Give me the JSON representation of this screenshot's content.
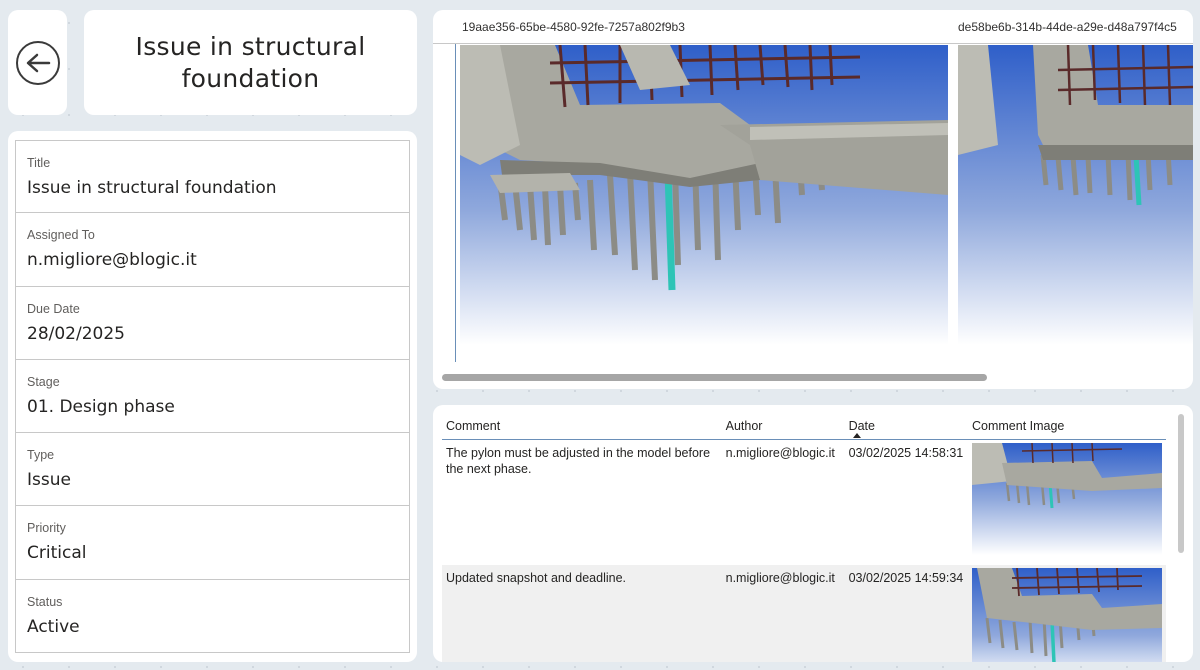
{
  "header": {
    "title": "Issue in structural foundation",
    "back_icon": "arrow-left-circle-icon"
  },
  "details": {
    "fields": [
      {
        "label": "Title",
        "value": "Issue in structural foundation"
      },
      {
        "label": "Assigned To",
        "value": "n.migliore@blogic.it"
      },
      {
        "label": "Due Date",
        "value": "28/02/2025"
      },
      {
        "label": "Stage",
        "value": "01. Design phase"
      },
      {
        "label": "Type",
        "value": "Issue"
      },
      {
        "label": "Priority",
        "value": "Critical"
      },
      {
        "label": "Status",
        "value": "Active"
      }
    ]
  },
  "images": {
    "ids": [
      "19aae356-65be-4580-92fe-7257a802f9b3",
      "de58be6b-314b-44de-a29e-d48a797f4c5"
    ]
  },
  "comments": {
    "columns": [
      "Comment",
      "Author",
      "Date",
      "Comment Image"
    ],
    "sorted_column": "Date",
    "rows": [
      {
        "comment": "The pylon must be adjusted in the model before the next phase.",
        "author": "n.migliore@blogic.it",
        "date": "03/02/2025 14:58:31"
      },
      {
        "comment": "Updated snapshot and deadline.",
        "author": "n.migliore@blogic.it",
        "date": "03/02/2025 14:59:34"
      }
    ]
  },
  "colors": {
    "sky_top": "#2f5fc9",
    "sky_bottom": "#ffffff",
    "concrete": "#9c9c94",
    "steel": "#5a2a2a",
    "highlight_pile": "#2ec4b6"
  }
}
